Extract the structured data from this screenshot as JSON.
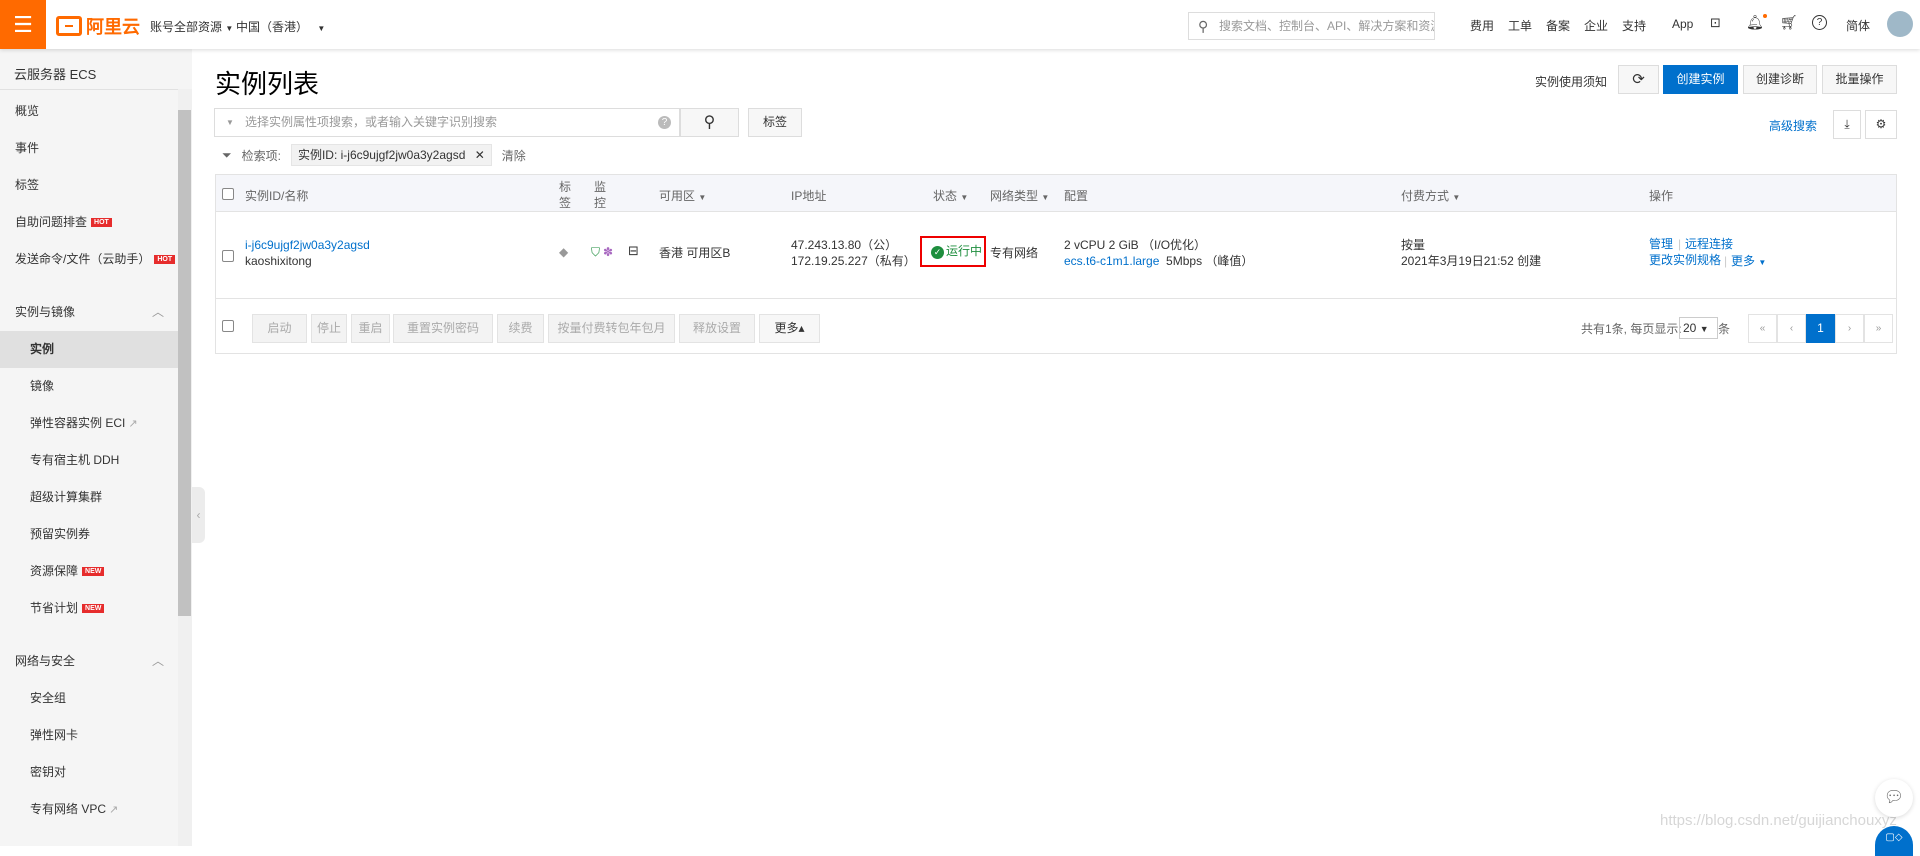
{
  "header": {
    "menu_icon": "hamburger-icon",
    "logo": "阿里云",
    "account_scope": "账号全部资源",
    "region": "中国（香港）",
    "search_placeholder": "搜索文档、控制台、API、解决方案和资源",
    "nav": [
      "费用",
      "工单",
      "备案",
      "企业",
      "支持",
      "App"
    ],
    "lang": "简体",
    "brand_color": "#ff6a00"
  },
  "sidebar": {
    "title": "云服务器 ECS",
    "top_items": [
      {
        "label": "概览"
      },
      {
        "label": "事件"
      },
      {
        "label": "标签"
      },
      {
        "label": "自助问题排查",
        "badge": "HOT"
      },
      {
        "label": "发送命令/文件（云助手）",
        "badge": "HOT"
      }
    ],
    "groups": [
      {
        "label": "实例与镜像",
        "items": [
          {
            "label": "实例",
            "active": true
          },
          {
            "label": "镜像"
          },
          {
            "label": "弹性容器实例 ECI",
            "external": true
          },
          {
            "label": "专有宿主机 DDH"
          },
          {
            "label": "超级计算集群"
          },
          {
            "label": "预留实例券"
          },
          {
            "label": "资源保障",
            "badge": "NEW"
          },
          {
            "label": "节省计划",
            "badge": "NEW"
          }
        ]
      },
      {
        "label": "网络与安全",
        "items": [
          {
            "label": "安全组"
          },
          {
            "label": "弹性网卡"
          },
          {
            "label": "密钥对"
          },
          {
            "label": "专有网络 VPC",
            "external": true
          }
        ]
      }
    ]
  },
  "main": {
    "title": "实例列表",
    "notice_link": "实例使用须知",
    "create_button": "创建实例",
    "diagnose_button": "创建诊断",
    "batch_button": "批量操作",
    "search_placeholder": "选择实例属性项搜索，或者输入关键字识别搜索",
    "tag_button": "标签",
    "advanced_search": "高级搜索",
    "filter_label": "检索项:",
    "filter_chip": "实例ID: i-j6c9ujgf2jw0a3y2agsd",
    "clear": "清除",
    "accent_color": "#0070cc"
  },
  "table": {
    "columns": {
      "id": "实例ID/名称",
      "tag_a": "标",
      "tag_b": "签",
      "mon_a": "监",
      "mon_b": "控",
      "zone": "可用区",
      "ip": "IP地址",
      "status": "状态",
      "network": "网络类型",
      "config": "配置",
      "billing": "付费方式",
      "actions": "操作"
    },
    "rows": [
      {
        "id": "i-j6c9ujgf2jw0a3y2agsd",
        "name": "kaoshixitong",
        "zone": "香港 可用区B",
        "public_ip": "47.243.13.80（公）",
        "private_ip": "172.19.25.227（私有）",
        "status": "运行中",
        "network": "专有网络",
        "config_line1": "2 vCPU 2 GiB （I/O优化）",
        "instance_type": "ecs.t6-c1m1.large",
        "bandwidth": "5Mbps （峰值）",
        "billing": "按量",
        "created": "2021年3月19日21:52 创建",
        "actions": {
          "manage": "管理",
          "remote": "远程连接",
          "change_spec": "更改实例规格",
          "more": "更多"
        }
      }
    ]
  },
  "footer": {
    "buttons": [
      "启动",
      "停止",
      "重启",
      "重置实例密码",
      "续费",
      "按量付费转包年包月",
      "释放设置"
    ],
    "more": "更多▴",
    "total": "共有1条, 每页显示:",
    "page_size": "20",
    "unit": "条",
    "pages": [
      "«",
      "‹",
      "1",
      "›",
      "»"
    ],
    "current_page": 1
  },
  "watermark": "https://blog.csdn.net/guijianchouxyz"
}
